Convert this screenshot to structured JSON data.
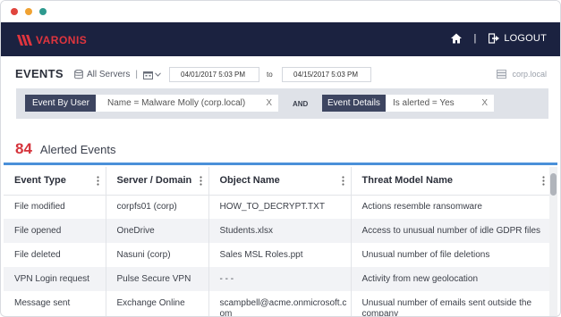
{
  "window": {
    "traffic_lights": [
      "#e0453e",
      "#f0a232",
      "#2e9a8f"
    ]
  },
  "appbar": {
    "brand": "VARONIS",
    "brand_color": "#e0353e",
    "background": "#1b2240",
    "home_icon": "home-icon",
    "separator": "|",
    "logout_label": "LOGOUT"
  },
  "filters": {
    "title": "EVENTS",
    "servers_label": "All Servers",
    "servers_sep": "|",
    "date_from": "04/01/2017 5:03 PM",
    "to_label": "to",
    "date_to": "04/15/2017 5:03 PM",
    "domain": "corp.local",
    "query": {
      "user_tag": "Event By User",
      "user_condition": "Name  =  Malware Molly (corp.local)",
      "user_remove": "X",
      "and_label": "AND",
      "details_tag": "Event Details",
      "details_condition": "Is alerted  =  Yes",
      "details_remove": "X"
    }
  },
  "summary": {
    "count": "84",
    "label": "Alerted Events",
    "accent": "#d5333b"
  },
  "table": {
    "columns": [
      "Event Type",
      "Server / Domain",
      "Object Name",
      "Threat Model Name"
    ],
    "rows": [
      [
        "File modified",
        "corpfs01 (corp)",
        "HOW_TO_DECRYPT.TXT",
        "Actions resemble ransomware"
      ],
      [
        "File opened",
        "OneDrive",
        "Students.xlsx",
        "Access to unusual number of idle GDPR files"
      ],
      [
        "File deleted",
        "Nasuni (corp)",
        "Sales MSL Roles.ppt",
        "Unusual number of file deletions"
      ],
      [
        "VPN Login request",
        "Pulse Secure VPN",
        "- - -",
        "Activity from new geolocation"
      ],
      [
        "Message sent",
        "Exchange Online",
        "scampbell@acme.onmicrosoft.com",
        "Unusual number of emails sent outside the company"
      ]
    ]
  }
}
